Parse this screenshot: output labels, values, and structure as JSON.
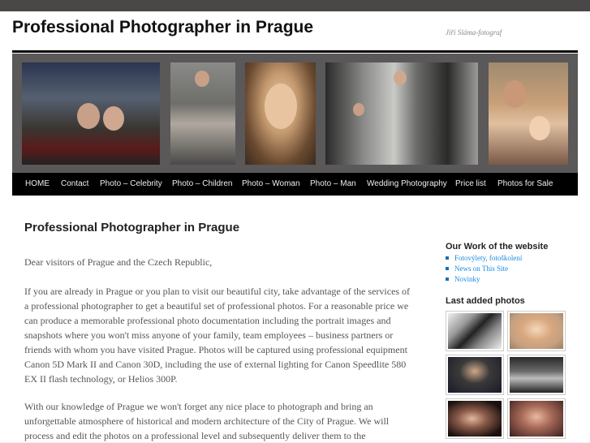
{
  "site": {
    "title": "Professional Photographer in Prague",
    "description": "Jiří Sláma-fotograf"
  },
  "nav": {
    "items": [
      "HOME",
      "Contact",
      "Photo – Celebrity",
      "Photo – Children",
      "Photo – Woman",
      "Photo – Man",
      "Wedding Photography",
      "Price list",
      "Photos for Sale"
    ]
  },
  "entry": {
    "title": "Professional Photographer in Prague",
    "paragraphs": [
      "Dear visitors of Prague and the Czech Republic,",
      "If you are already in Prague or you plan to visit our beautiful city, take advantage of the services of a professional photographer to get a beautiful set of professional photos. For a reasonable price we can produce a memorable professional photo documentation including the portrait images and snapshots where you won't miss anyone of your family, team employees – business partners or friends with whom you have visited Prague. Photos will be captured using professional equipment Canon 5D Mark II and Canon 30D, including the use of external lighting for Canon Speedlite 580 EX II flash technology, or Helios 300P.",
      "With our knowledge of Prague we won't forget any nice place to photograph and bring an unforgettable atmosphere of historical and modern architecture of the City of Prague. We will process and edit the photos on a professional level and subsequently deliver them to the"
    ]
  },
  "sidebar": {
    "work_title": "Our Work of the website",
    "work_links": [
      "Fotovýlety, fotoškolení",
      "News on This Site",
      "Novinky"
    ],
    "photos_title": "Last added photos"
  },
  "colors": {
    "topbar": "#4a4747",
    "nav_bg": "#000000",
    "link": "#1b8be0"
  }
}
